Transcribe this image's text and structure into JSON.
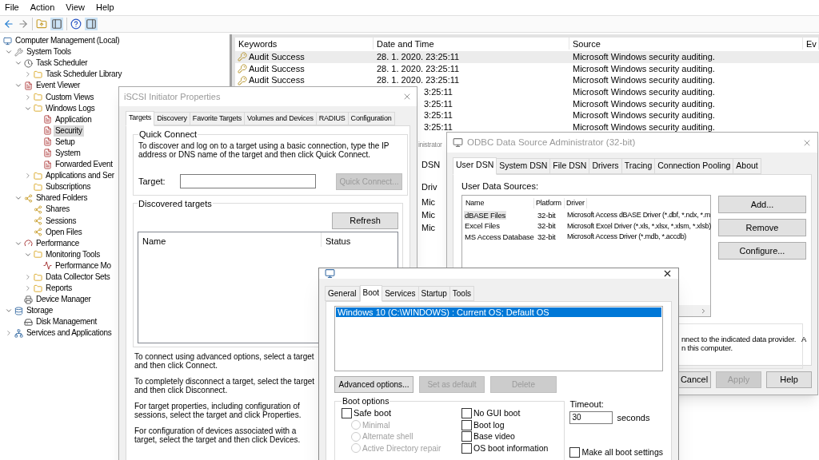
{
  "menu": [
    "File",
    "Action",
    "View",
    "Help"
  ],
  "tree": {
    "label": "Computer Management (Local)",
    "kind": "computer",
    "selected": false,
    "children": [
      {
        "label": "System Tools",
        "kind": "tools",
        "selected": false,
        "expanded": true,
        "children": [
          {
            "label": "Task Scheduler",
            "kind": "clock",
            "selected": false,
            "expanded": true,
            "children": [
              {
                "label": "Task Scheduler Library",
                "kind": "folder",
                "selected": false,
                "expanded": false
              }
            ]
          },
          {
            "label": "Event Viewer",
            "kind": "log",
            "selected": false,
            "expanded": true,
            "children": [
              {
                "label": "Custom Views",
                "kind": "folder",
                "selected": false,
                "expanded": false
              },
              {
                "label": "Windows Logs",
                "kind": "folder",
                "selected": false,
                "expanded": true,
                "children": [
                  {
                    "label": "Application",
                    "kind": "log",
                    "selected": false
                  },
                  {
                    "label": "Security",
                    "kind": "log",
                    "selected": true
                  },
                  {
                    "label": "Setup",
                    "kind": "log",
                    "selected": false
                  },
                  {
                    "label": "System",
                    "kind": "log",
                    "selected": false
                  },
                  {
                    "label": "Forwarded Event",
                    "kind": "log",
                    "selected": false
                  }
                ]
              },
              {
                "label": "Applications and Ser",
                "kind": "folder",
                "selected": false,
                "expanded": false
              },
              {
                "label": "Subscriptions",
                "kind": "folder",
                "selected": false
              }
            ]
          },
          {
            "label": "Shared Folders",
            "kind": "share",
            "selected": false,
            "expanded": true,
            "children": [
              {
                "label": "Shares",
                "kind": "share",
                "selected": false
              },
              {
                "label": "Sessions",
                "kind": "share",
                "selected": false
              },
              {
                "label": "Open Files",
                "kind": "share",
                "selected": false
              }
            ]
          },
          {
            "label": "Performance",
            "kind": "gauge",
            "selected": false,
            "expanded": true,
            "children": [
              {
                "label": "Monitoring Tools",
                "kind": "folder",
                "selected": false,
                "expanded": true,
                "children": [
                  {
                    "label": "Performance Mo",
                    "kind": "chart",
                    "selected": false
                  }
                ]
              },
              {
                "label": "Data Collector Sets",
                "kind": "folder",
                "selected": false,
                "expanded": false
              },
              {
                "label": "Reports",
                "kind": "folder",
                "selected": false,
                "expanded": false
              }
            ]
          },
          {
            "label": "Device Manager",
            "kind": "device",
            "selected": false
          }
        ]
      },
      {
        "label": "Storage",
        "kind": "storage",
        "selected": false,
        "expanded": true,
        "children": [
          {
            "label": "Disk Management",
            "kind": "disk",
            "selected": false
          }
        ]
      },
      {
        "label": "Services and Applications",
        "kind": "services",
        "selected": false,
        "expanded": false
      }
    ]
  },
  "events": {
    "columns": [
      "Keywords",
      "Date and Time",
      "Source",
      "Ev"
    ],
    "rows": [
      {
        "keyword": "Audit Success",
        "date": "28. 1. 2020. 23:25:11",
        "source": "Microsoft Windows security auditing.",
        "selected": true
      },
      {
        "keyword": "Audit Success",
        "date": "28. 1. 2020. 23:25:11",
        "source": "Microsoft Windows security auditing.",
        "selected": false
      },
      {
        "keyword": "Audit Success",
        "date": "28. 1. 2020. 23:25:11",
        "source": "Microsoft Windows security auditing.",
        "selected": false
      },
      {
        "date": "3:25:11",
        "source": "Microsoft Windows security auditing.",
        "selected": false
      },
      {
        "date": "3:25:11",
        "source": "Microsoft Windows security auditing.",
        "selected": false
      },
      {
        "date": "3:25:11",
        "source": "Microsoft Windows security auditing.",
        "selected": false
      },
      {
        "date": "3:25:11",
        "source": "Microsoft Windows security auditing.",
        "selected": false
      }
    ]
  },
  "background_window": {
    "title": "inistrator",
    "tab": "DSN",
    "column": "Driv",
    "cells": [
      "Mic",
      "Mic",
      "Mic"
    ]
  },
  "iscsi": {
    "title": "iSCSI Initiator Properties",
    "tabs": [
      {
        "label": "Targets",
        "selected": true
      },
      {
        "label": "Discovery",
        "selected": false
      },
      {
        "label": "Favorite Targets",
        "selected": false
      },
      {
        "label": "Volumes and Devices",
        "selected": false
      },
      {
        "label": "RADIUS",
        "selected": false
      },
      {
        "label": "Configuration",
        "selected": false
      }
    ],
    "quick_connect": {
      "title": "Quick Connect",
      "text": "To discover and log on to a target using a basic connection, type the IP address or DNS name of the target and then click Quick Connect.",
      "target_label": "Target:",
      "button": {
        "label": "Quick Connect...",
        "disabled": true
      }
    },
    "discovered": {
      "title": "Discovered targets",
      "refresh": "Refresh",
      "columns": [
        "Name",
        "Status"
      ]
    },
    "help": [
      "To connect using advanced options, select a target and then click Connect.",
      "To completely disconnect a target, select the target and then click Disconnect.",
      "For target properties, including configuration of sessions, select the target and click Properties.",
      "For configuration of devices associated with a target, select the target and then click Devices."
    ]
  },
  "odbc": {
    "title": "ODBC Data Source Administrator (32-bit)",
    "tabs": [
      {
        "label": "User DSN",
        "selected": true
      },
      {
        "label": "System DSN",
        "selected": false
      },
      {
        "label": "File DSN",
        "selected": false
      },
      {
        "label": "Drivers",
        "selected": false
      },
      {
        "label": "Tracing",
        "selected": false
      },
      {
        "label": "Connection Pooling",
        "selected": false
      },
      {
        "label": "About",
        "selected": false
      }
    ],
    "sources_label": "User Data Sources:",
    "columns": [
      "Name",
      "Platform",
      "Driver"
    ],
    "rows": [
      {
        "name": "dBASE Files",
        "platform": "32-bit",
        "driver": "Microsoft Access dBASE Driver (*.dbf, *.ndx, *.m",
        "selected": true
      },
      {
        "name": "Excel Files",
        "platform": "32-bit",
        "driver": "Microsoft Excel Driver (*.xls, *.xlsx, *.xlsm, *.xlsb)",
        "selected": false
      },
      {
        "name": "MS Access Database",
        "platform": "32-bit",
        "driver": "Microsoft Access Driver (*.mdb, *.accdb)",
        "selected": false
      }
    ],
    "buttons": [
      "Add...",
      "Remove",
      "Configure..."
    ],
    "description": [
      "nnect to the indicated data provider.   A",
      "n this computer."
    ],
    "footer_buttons": [
      {
        "label": "Cancel",
        "disabled": false
      },
      {
        "label": "Apply",
        "disabled": true
      },
      {
        "label": "Help",
        "disabled": false
      }
    ]
  },
  "boot": {
    "tabs": [
      {
        "label": "General",
        "selected": false
      },
      {
        "label": "Boot",
        "selected": true
      },
      {
        "label": "Services",
        "selected": false
      },
      {
        "label": "Startup",
        "selected": false
      },
      {
        "label": "Tools",
        "selected": false
      }
    ],
    "entries": [
      {
        "label": "Windows 10 (C:\\WINDOWS) : Current OS; Default OS",
        "selected": true
      }
    ],
    "buttons": [
      {
        "label": "Advanced options...",
        "disabled": false
      },
      {
        "label": "Set as default",
        "disabled": true
      },
      {
        "label": "Delete",
        "disabled": true
      }
    ],
    "options_title": "Boot options",
    "left_options": [
      {
        "kind": "checkbox",
        "label": "Safe boot",
        "checked": false,
        "disabled": false
      },
      {
        "kind": "radio",
        "label": "Minimal",
        "selected": false,
        "disabled": true
      },
      {
        "kind": "radio",
        "label": "Alternate shell",
        "selected": false,
        "disabled": true
      },
      {
        "kind": "radio",
        "label": "Active Directory repair",
        "selected": false,
        "disabled": true
      }
    ],
    "right_options": [
      {
        "label": "No GUI boot",
        "checked": false
      },
      {
        "label": "Boot log",
        "checked": false
      },
      {
        "label": "Base video",
        "checked": false
      },
      {
        "label": "OS boot information",
        "checked": false
      }
    ],
    "timeout": {
      "label": "Timeout:",
      "value": "30",
      "unit": "seconds"
    },
    "make_permanent": {
      "label": "Make all boot settings",
      "checked": false
    }
  }
}
